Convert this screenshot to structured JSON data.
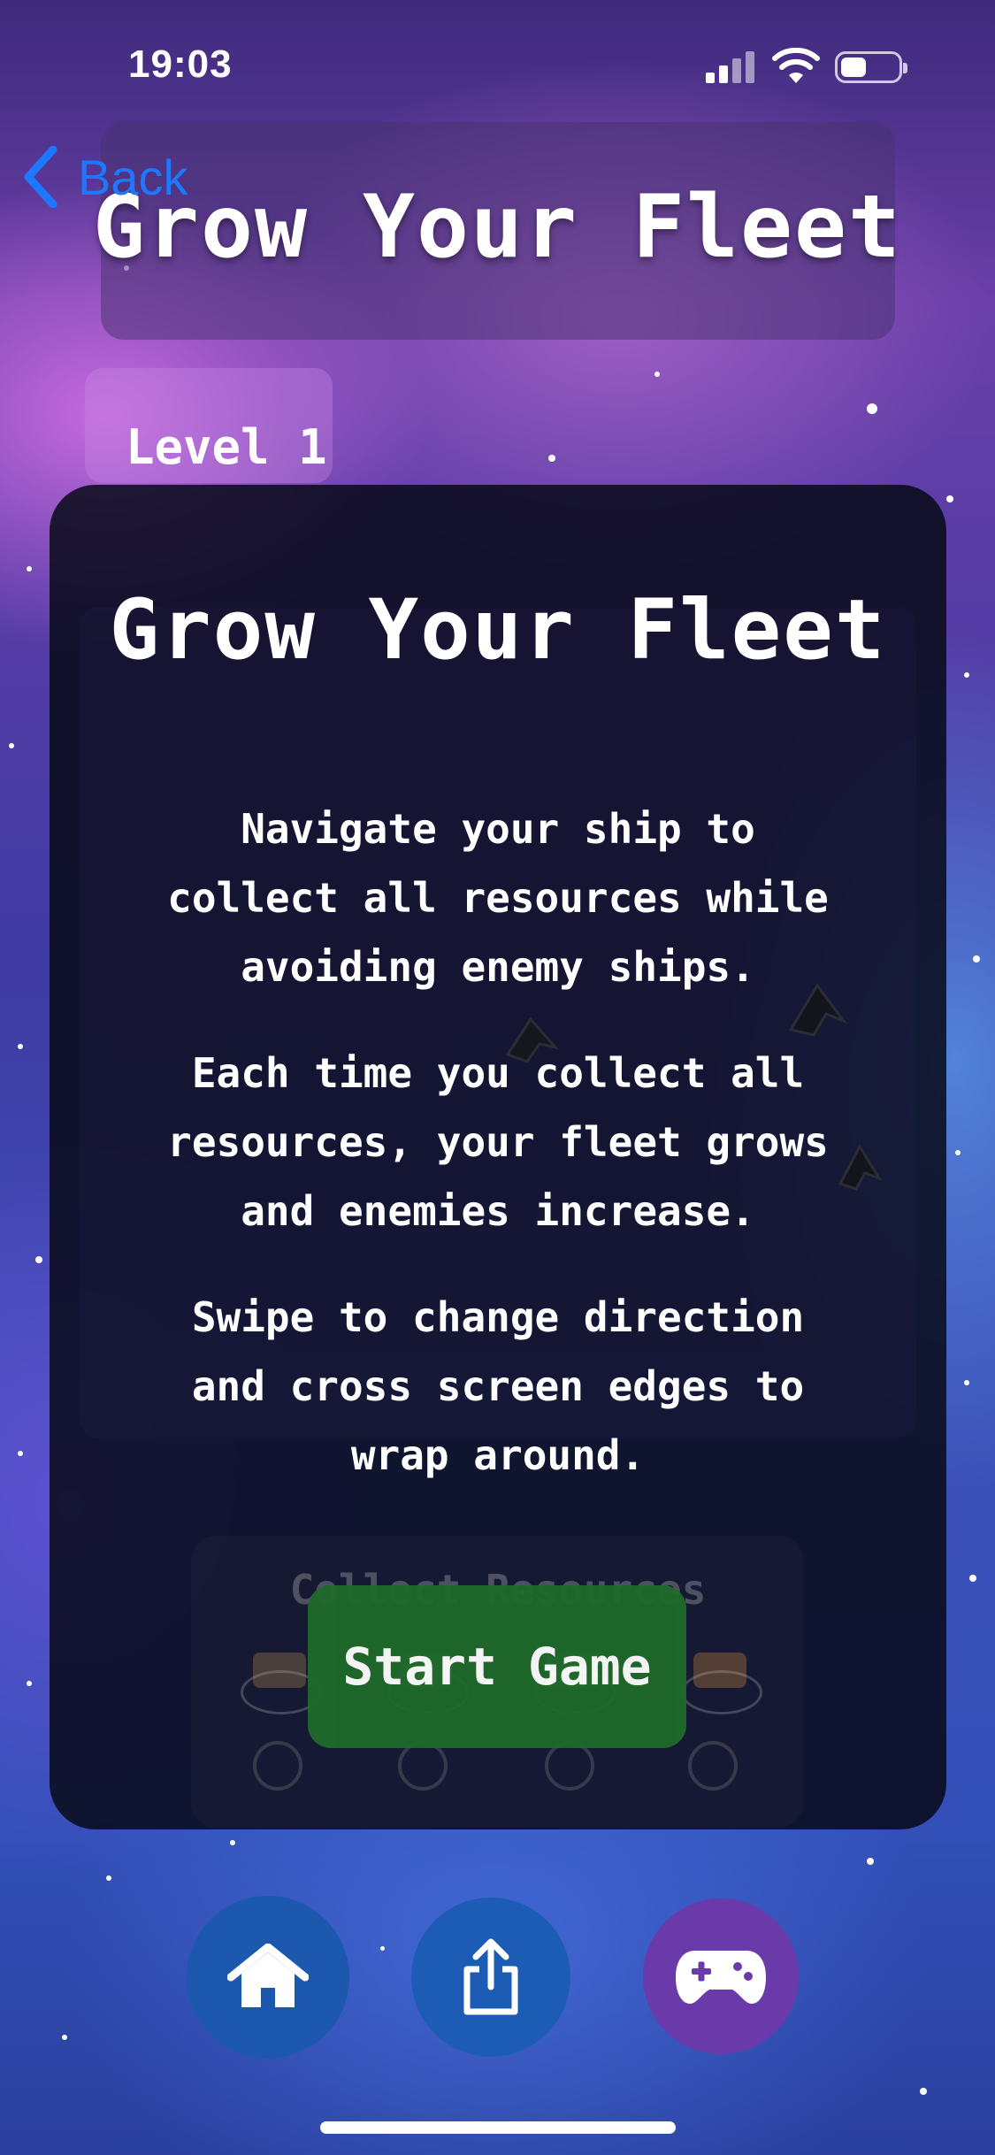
{
  "status_bar": {
    "time": "19:03"
  },
  "header": {
    "back_label": "Back",
    "title": "Grow Your Fleet"
  },
  "level": {
    "label": "Level 1"
  },
  "modal": {
    "title": "Grow Your Fleet",
    "paragraphs": [
      "Navigate your ship to collect all resources while avoiding enemy ships.",
      "Each time you collect all resources, your fleet grows and enemies increase.",
      "Swipe to change direction and cross screen edges to wrap around."
    ],
    "collect_label": "Collect Resources",
    "start_button": "Start Game"
  },
  "bottom_nav": {
    "home_icon": "home-icon",
    "share_icon": "share-icon",
    "game_icon": "gamepad-icon"
  },
  "colors": {
    "back_link": "#1e78ff",
    "start_button": "#1f6a2a",
    "home_button": "#1c58ad",
    "share_button": "#1d5cb5",
    "game_button": "#6a3aaa"
  }
}
